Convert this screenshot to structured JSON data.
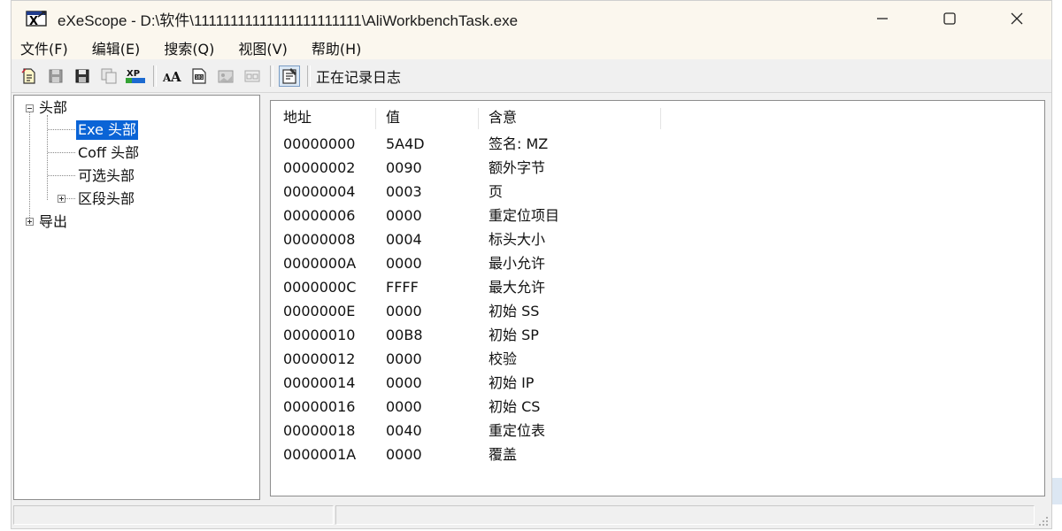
{
  "window": {
    "title": "eXeScope - D:\\软件\\11111111111111111111111\\AliWorkbenchTask.exe",
    "controls": {
      "minimize": "—",
      "maximize": "☐",
      "close": "✕"
    }
  },
  "menubar": {
    "items": [
      {
        "label": "文件(F)"
      },
      {
        "label": "编辑(E)"
      },
      {
        "label": "搜索(Q)"
      },
      {
        "label": "视图(V)"
      },
      {
        "label": "帮助(H)"
      }
    ]
  },
  "toolbar": {
    "log_label": "正在记录日志"
  },
  "tree": {
    "root": "头部",
    "children": [
      "Exe 头部",
      "Coff 头部",
      "可选头部",
      "区段头部"
    ],
    "export": "导出"
  },
  "table": {
    "columns": [
      "地址",
      "值",
      "含意"
    ],
    "rows": [
      {
        "address": "00000000",
        "value": "5A4D",
        "meaning": "签名: MZ"
      },
      {
        "address": "00000002",
        "value": "0090",
        "meaning": "额外字节"
      },
      {
        "address": "00000004",
        "value": "0003",
        "meaning": "页"
      },
      {
        "address": "00000006",
        "value": "0000",
        "meaning": "重定位项目"
      },
      {
        "address": "00000008",
        "value": "0004",
        "meaning": "标头大小"
      },
      {
        "address": "0000000A",
        "value": "0000",
        "meaning": "最小允许"
      },
      {
        "address": "0000000C",
        "value": "FFFF",
        "meaning": "最大允许"
      },
      {
        "address": "0000000E",
        "value": "0000",
        "meaning": "初始 SS"
      },
      {
        "address": "00000010",
        "value": "00B8",
        "meaning": "初始 SP"
      },
      {
        "address": "00000012",
        "value": "0000",
        "meaning": "校验"
      },
      {
        "address": "00000014",
        "value": "0000",
        "meaning": "初始 IP"
      },
      {
        "address": "00000016",
        "value": "0000",
        "meaning": "初始 CS"
      },
      {
        "address": "00000018",
        "value": "0040",
        "meaning": "重定位表"
      },
      {
        "address": "0000001A",
        "value": "0000",
        "meaning": "覆盖"
      }
    ]
  },
  "colors": {
    "selection": "#0a64d6",
    "titlebar": "#fbf7ee",
    "chrome": "#f0f0f0"
  }
}
